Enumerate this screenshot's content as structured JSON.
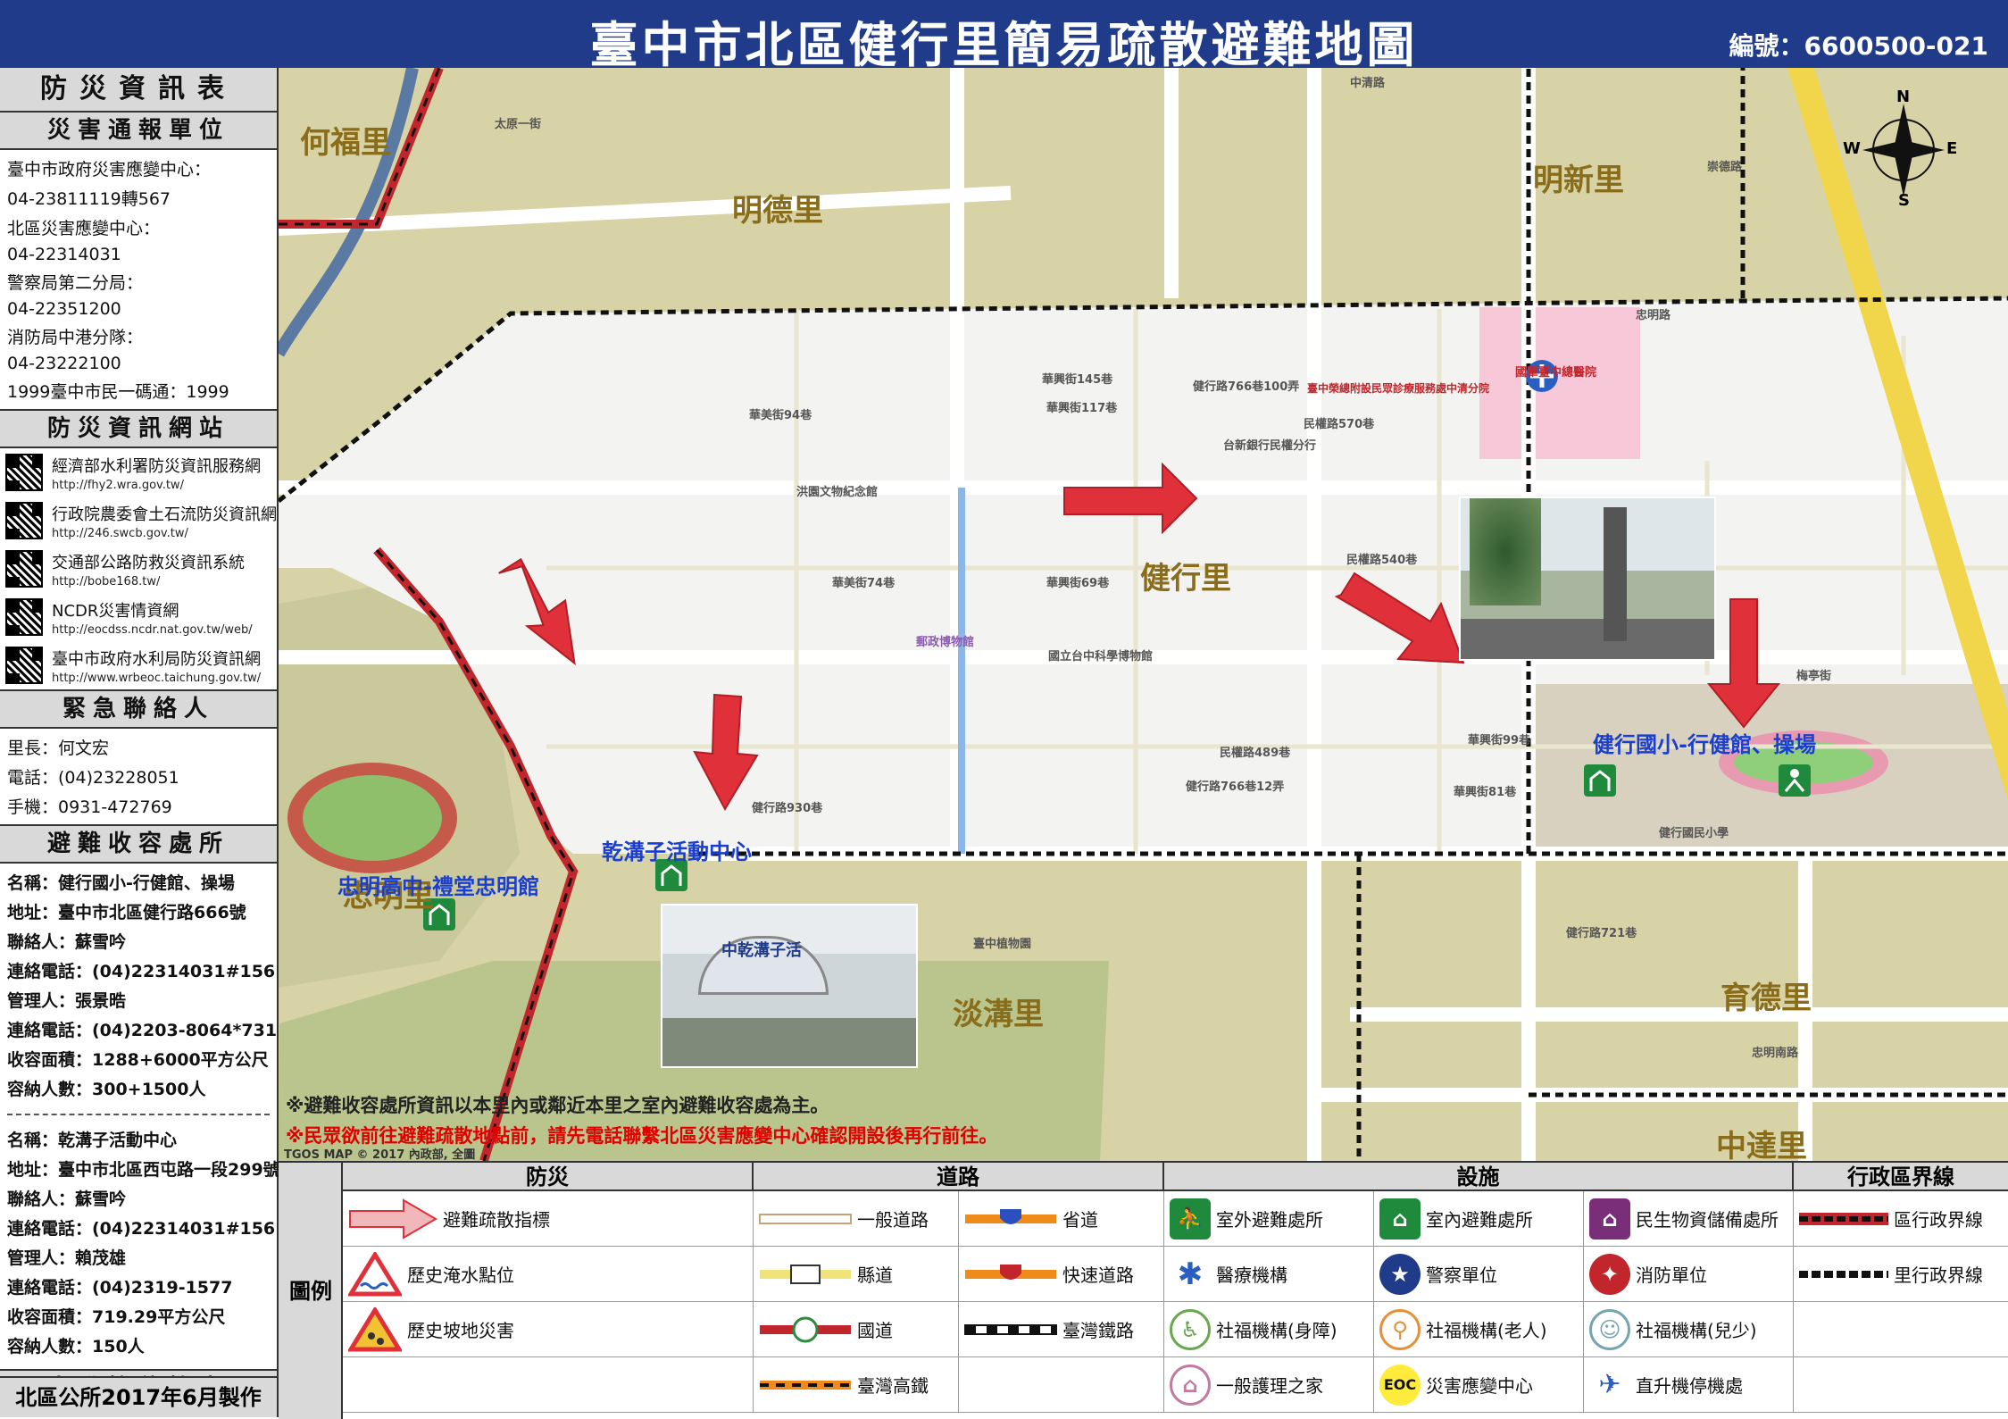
{
  "header": {
    "title": "臺中市北區健行里簡易疏散避難地圖",
    "code": "編號：6600500-021"
  },
  "sidebar": {
    "main_title": "防災資訊表",
    "report_title": "災害通報單位",
    "report_lines": [
      "臺中市政府災害應變中心：",
      "04-23811119轉567",
      "北區災害應變中心：",
      "04-22314031",
      "警察局第二分局：",
      "04-22351200",
      "消防局中港分隊：",
      "04-23222100",
      "1999臺中市民一碼通：1999"
    ],
    "sites_title": "防災資訊網站",
    "sites": [
      {
        "name": "經濟部水利署防災資訊服務網",
        "url": "http://fhy2.wra.gov.tw/"
      },
      {
        "name": "行政院農委會土石流防災資訊網",
        "url": "http://246.swcb.gov.tw/"
      },
      {
        "name": "交通部公路防救災資訊系統",
        "url": "http://bobe168.tw/"
      },
      {
        "name": "NCDR災害情資網",
        "url": "http://eocdss.ncdr.nat.gov.tw/web/"
      },
      {
        "name": "臺中市政府水利局防災資訊網",
        "url": "http://www.wrbeoc.taichung.gov.tw/"
      }
    ],
    "contact_title": "緊急聯絡人",
    "contact_lines": [
      "里長：何文宏",
      "電話：(04)23228051",
      "手機：0931-472769"
    ],
    "shelter_title": "避難收容處所",
    "shelter1": [
      "名稱：健行國小-行健館、操場",
      "地址：臺中市北區健行路666號",
      "聯絡人：蘇雪吟",
      "連絡電話：(04)22314031#156",
      "管理人：張景晧",
      "連絡電話：(04)2203-8064*731",
      "收容面積：1288+6000平方公尺",
      "容納人數：300+1500人"
    ],
    "shelter2": [
      "名稱：乾溝子活動中心",
      "地址：臺中市北區西屯路一段299號",
      "聯絡人：蘇雪吟",
      "連絡電話：(04)22314031#156",
      "管理人：賴茂雄",
      "連絡電話：(04)2319-1577",
      "收容面積：719.29平方公尺",
      "容納人數：150人"
    ],
    "heli_title": "直升機停機處",
    "credit": "北區公所2017年6月製作"
  },
  "map": {
    "areas": {
      "hefu": "何福里",
      "mingde": "明德里",
      "mingxin": "明新里",
      "jianxing": "健行里",
      "danguo": "淡溝里",
      "yude": "育德里",
      "zhongda": "中達里",
      "zhongming": "忠明里"
    },
    "shelter_labels": {
      "school": "健行國小-行健館、操場",
      "center": "乾溝子活動中心",
      "zhongming_hs": "忠明高中-禮堂忠明館"
    },
    "streets": [
      "忠明路",
      "民權路570巷",
      "民權路540巷",
      "民權路489巷",
      "健行路766巷100弄",
      "健行路766巷12弄",
      "華興街145巷",
      "華興街117巷",
      "華美街94巷",
      "華美街74巷",
      "華興街69巷",
      "梅亭街",
      "健行路930巷",
      "華興街99巷",
      "華興街81巷",
      "健行路721巷",
      "太原一街",
      "忠明南路",
      "崇德路",
      "中清路"
    ],
    "places": [
      "國軍臺中總醫院",
      "臺中榮總附設民眾診療服務處中清分院",
      "台新銀行民權分行",
      "洪園文物紀念館",
      "郵政博物館",
      "國立台中科學博物館",
      "臺中植物園",
      "健行國民小學"
    ],
    "note1": "※避難收容處所資訊以本里內或鄰近本里之室內避難收容處為主。",
    "note2": "※民眾欲前往避難疏散地點前，請先電話聯繫北區災害應變中心確認開設後再行前往。",
    "tgos": "TGOS MAP © 2017 內政部, 全圖",
    "compass": {
      "n": "N",
      "s": "S",
      "e": "E",
      "w": "W"
    },
    "photo_sign_text": "中乾溝子活"
  },
  "legend": {
    "title": "圖例",
    "headers": {
      "disaster": "防災",
      "road": "道路",
      "facility": "設施",
      "boundary": "行政區界線"
    },
    "disaster": [
      "避難疏散指標",
      "歷史淹水點位",
      "歷史坡地災害"
    ],
    "road": [
      "一般道路",
      "縣道",
      "國道",
      "臺灣高鐵",
      "省道",
      "快速道路",
      "臺灣鐵路"
    ],
    "facility": [
      "室外避難處所",
      "室內避難處所",
      "民生物資儲備處所",
      "醫療機構",
      "警察單位",
      "消防單位",
      "社福機構(身障)",
      "社福機構(老人)",
      "社福機構(兒少)",
      "一般護理之家",
      "災害應變中心",
      "直升機停機處"
    ],
    "eoc_text": "EOC",
    "boundary": [
      "區行政界線",
      "里行政界線"
    ]
  },
  "colors": {
    "header": "#1f3b8a",
    "arrow": "#e0303a",
    "shelter_green": "#1f8a3c",
    "boundary": "#c0262b"
  }
}
